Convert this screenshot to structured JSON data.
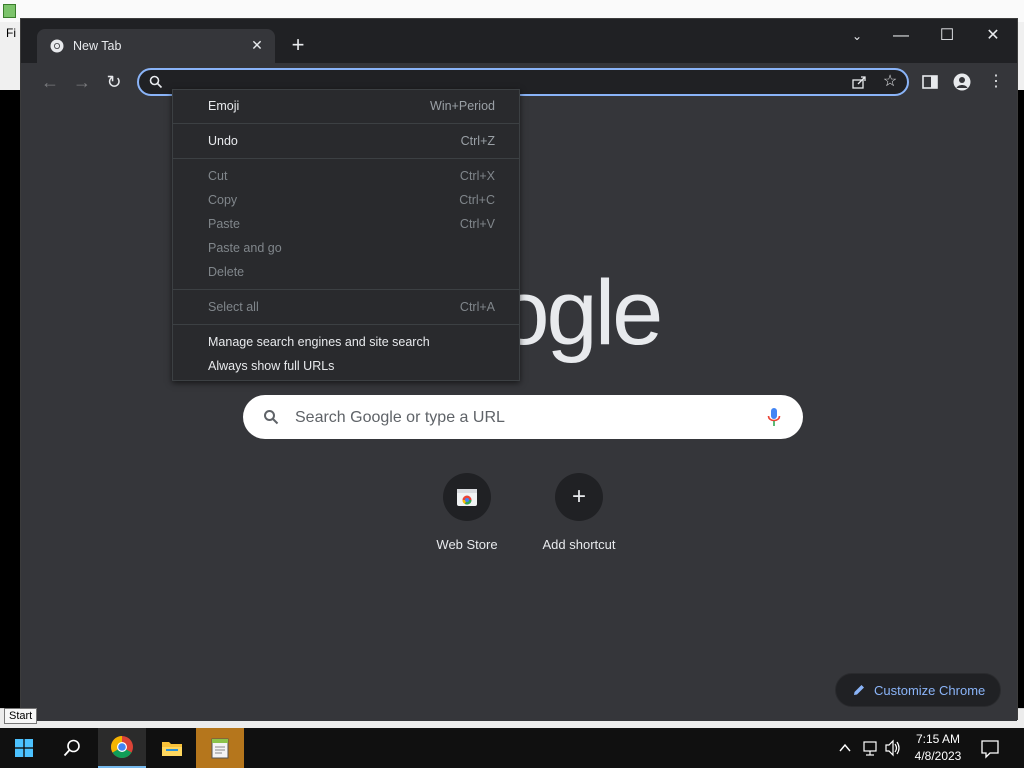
{
  "background_window": {
    "menu_text": "Fi"
  },
  "chrome": {
    "tab": {
      "title": "New Tab"
    },
    "window_controls": {
      "minimize": "—",
      "maximize": "☐",
      "close": "✕"
    },
    "omnibox": {
      "value": "",
      "placeholder": ""
    },
    "logo_text": "Google",
    "search_placeholder": "Search Google or type a URL",
    "shortcuts": [
      {
        "label": "Web Store"
      },
      {
        "label": "Add shortcut"
      }
    ],
    "customize_label": "Customize Chrome"
  },
  "context_menu": {
    "items": [
      {
        "label": "Emoji",
        "shortcut": "Win+Period",
        "enabled": true
      },
      {
        "label": "Undo",
        "shortcut": "Ctrl+Z",
        "enabled": true
      },
      {
        "label": "Cut",
        "shortcut": "Ctrl+X",
        "enabled": false
      },
      {
        "label": "Copy",
        "shortcut": "Ctrl+C",
        "enabled": false
      },
      {
        "label": "Paste",
        "shortcut": "Ctrl+V",
        "enabled": false
      },
      {
        "label": "Paste and go",
        "shortcut": "",
        "enabled": false
      },
      {
        "label": "Delete",
        "shortcut": "",
        "enabled": false
      },
      {
        "label": "Select all",
        "shortcut": "Ctrl+A",
        "enabled": false
      },
      {
        "label": "Manage search engines and site search",
        "shortcut": "",
        "enabled": true
      },
      {
        "label": "Always show full URLs",
        "shortcut": "",
        "enabled": true
      }
    ]
  },
  "taskbar": {
    "start_tooltip": "Start",
    "time": "7:15 AM",
    "date": "4/8/2023"
  },
  "colors": {
    "accent": "#8ab4f8",
    "chrome_frame": "#202124",
    "content_bg": "#35363a",
    "menu_bg": "#292a2d"
  }
}
